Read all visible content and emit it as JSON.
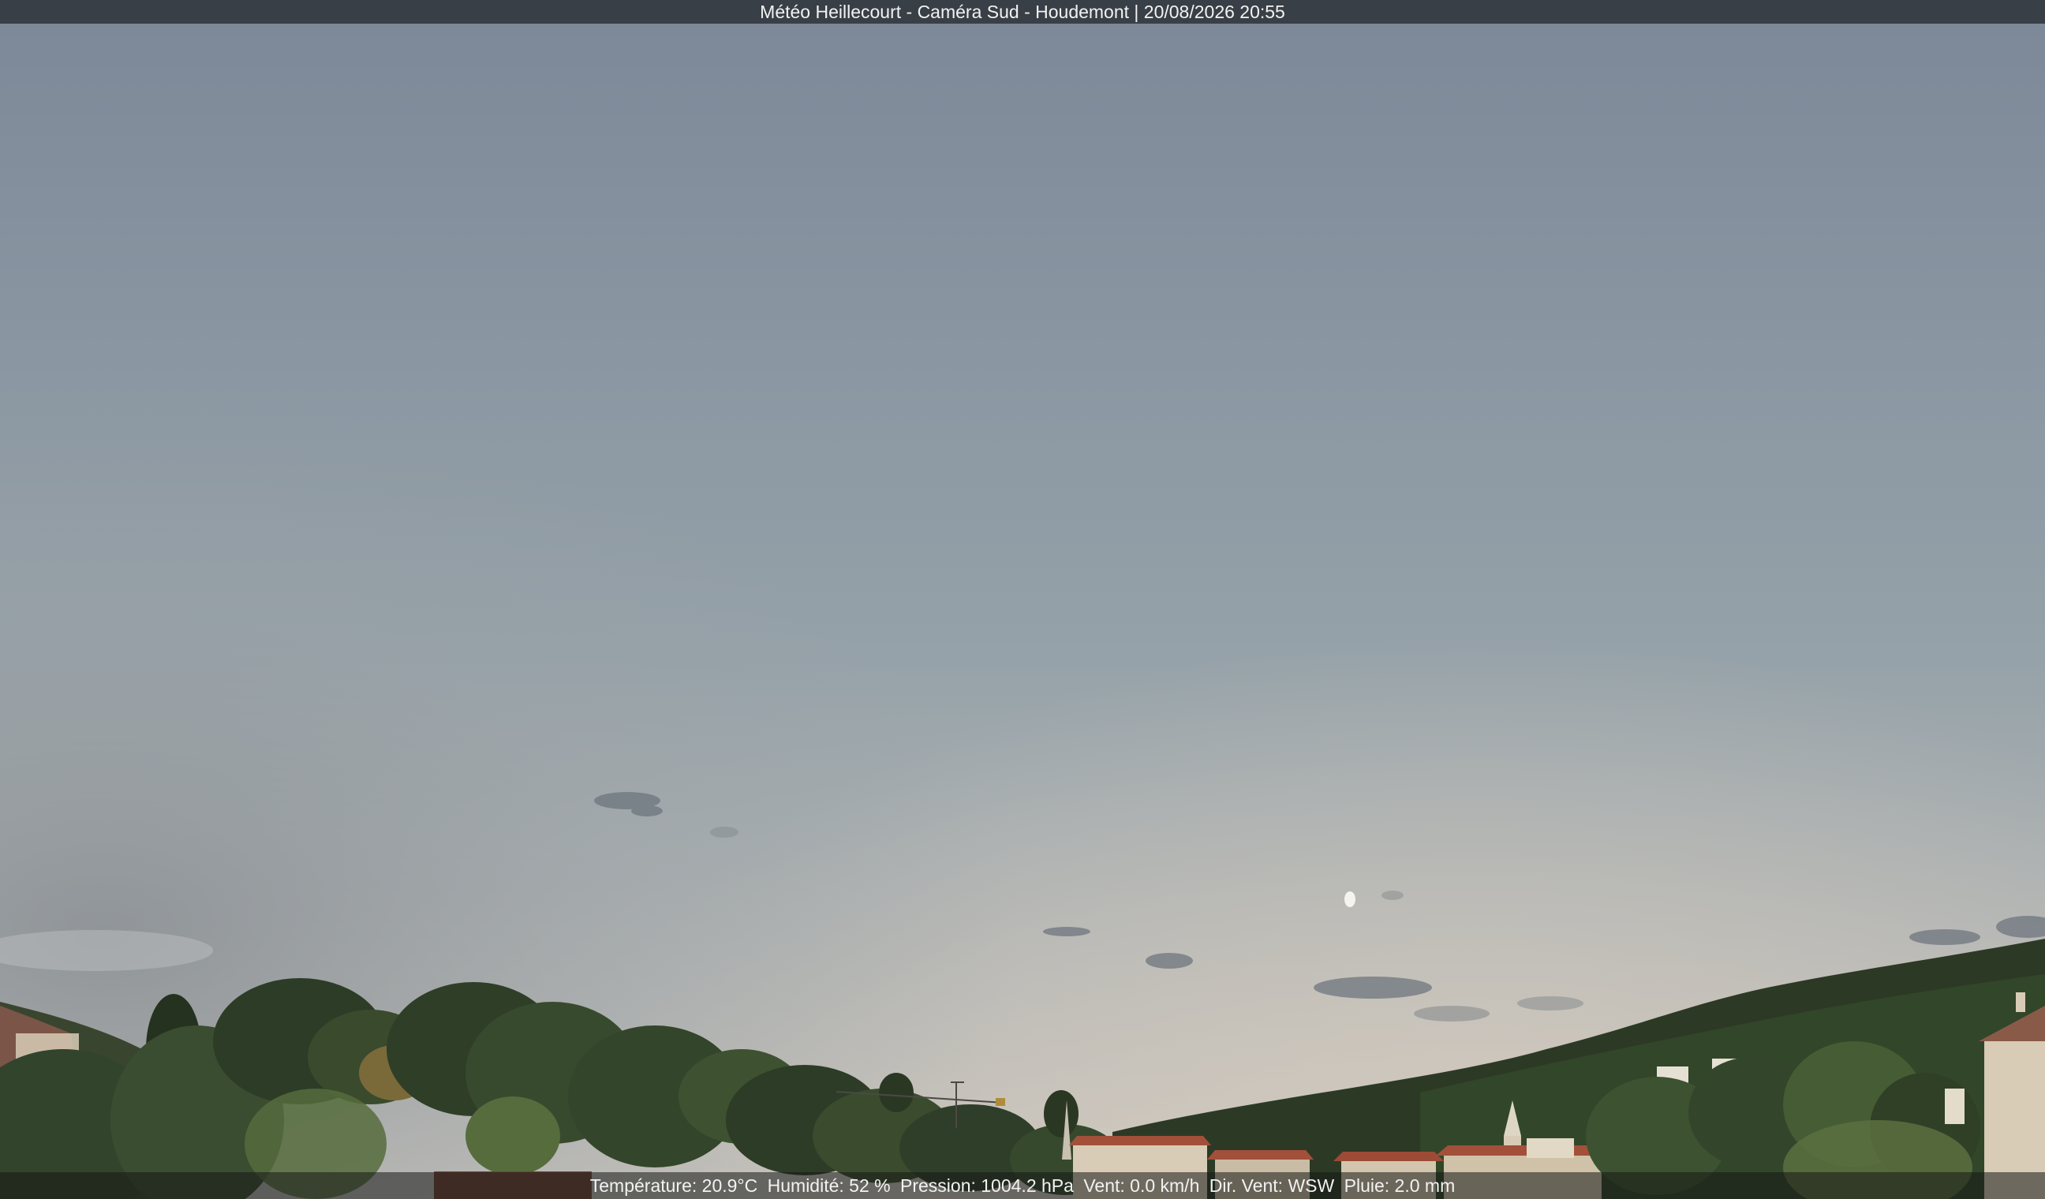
{
  "overlay": {
    "title": "Météo Heillecourt - Caméra Sud - Houdemont | 20/08/2026 20:55",
    "weather": {
      "temperature": "Température: 20.9°C",
      "humidity": "Humidité: 52 %",
      "pressure": "Pression: 1004.2 hPa",
      "wind_speed": "Vent: 0.0 km/h",
      "wind_dir": "Dir. Vent: WSW",
      "rain": "Pluie: 2.0 mm"
    }
  },
  "colors": {
    "sky_top": "#7c8898",
    "sky_mid": "#96a2a9",
    "sky_horizon": "#c8c4bd",
    "haze_left": "#8a8f93",
    "hill_dark": "#25321f",
    "hill_mid": "#344a2b",
    "foliage_light": "#566c3d",
    "foliage_autumn": "#7a6a3a",
    "roof_red": "#a2503a",
    "facade_light": "#d8ccb6"
  }
}
